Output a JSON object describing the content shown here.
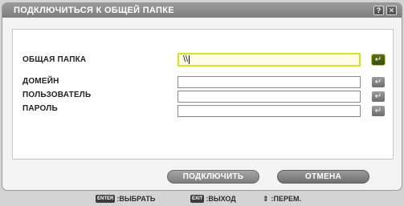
{
  "dialog": {
    "title": "ПОДКЛЮЧИТЬСЯ К ОБЩЕЙ ПАПКЕ",
    "help_glyph": "?",
    "close_glyph": "✕"
  },
  "form": {
    "shared_folder_label": "ОБЩАЯ ПАПКА",
    "shared_folder_value": "\\\\",
    "domain_label": "ДОМЕЙН",
    "domain_value": "",
    "user_label": "ПОЛЬЗОВАТЕЛЬ",
    "user_value": "",
    "password_label": "ПАРОЛЬ",
    "password_value": "",
    "enter_glyph": "↵"
  },
  "buttons": {
    "connect_label": "ПОДКЛЮЧИТЬ",
    "cancel_label": "ОТМЕНА"
  },
  "footer": {
    "enter_key": "ENTER",
    "enter_text": ":ВЫБРАТЬ",
    "exit_key": "EXIT",
    "exit_text": ":ВЫХОД",
    "move_glyph": "⇕",
    "move_text": ":ПЕРЕМ."
  },
  "colors": {
    "active_field_border": "#d8e41a",
    "title_bar": "#8a8a8a"
  }
}
